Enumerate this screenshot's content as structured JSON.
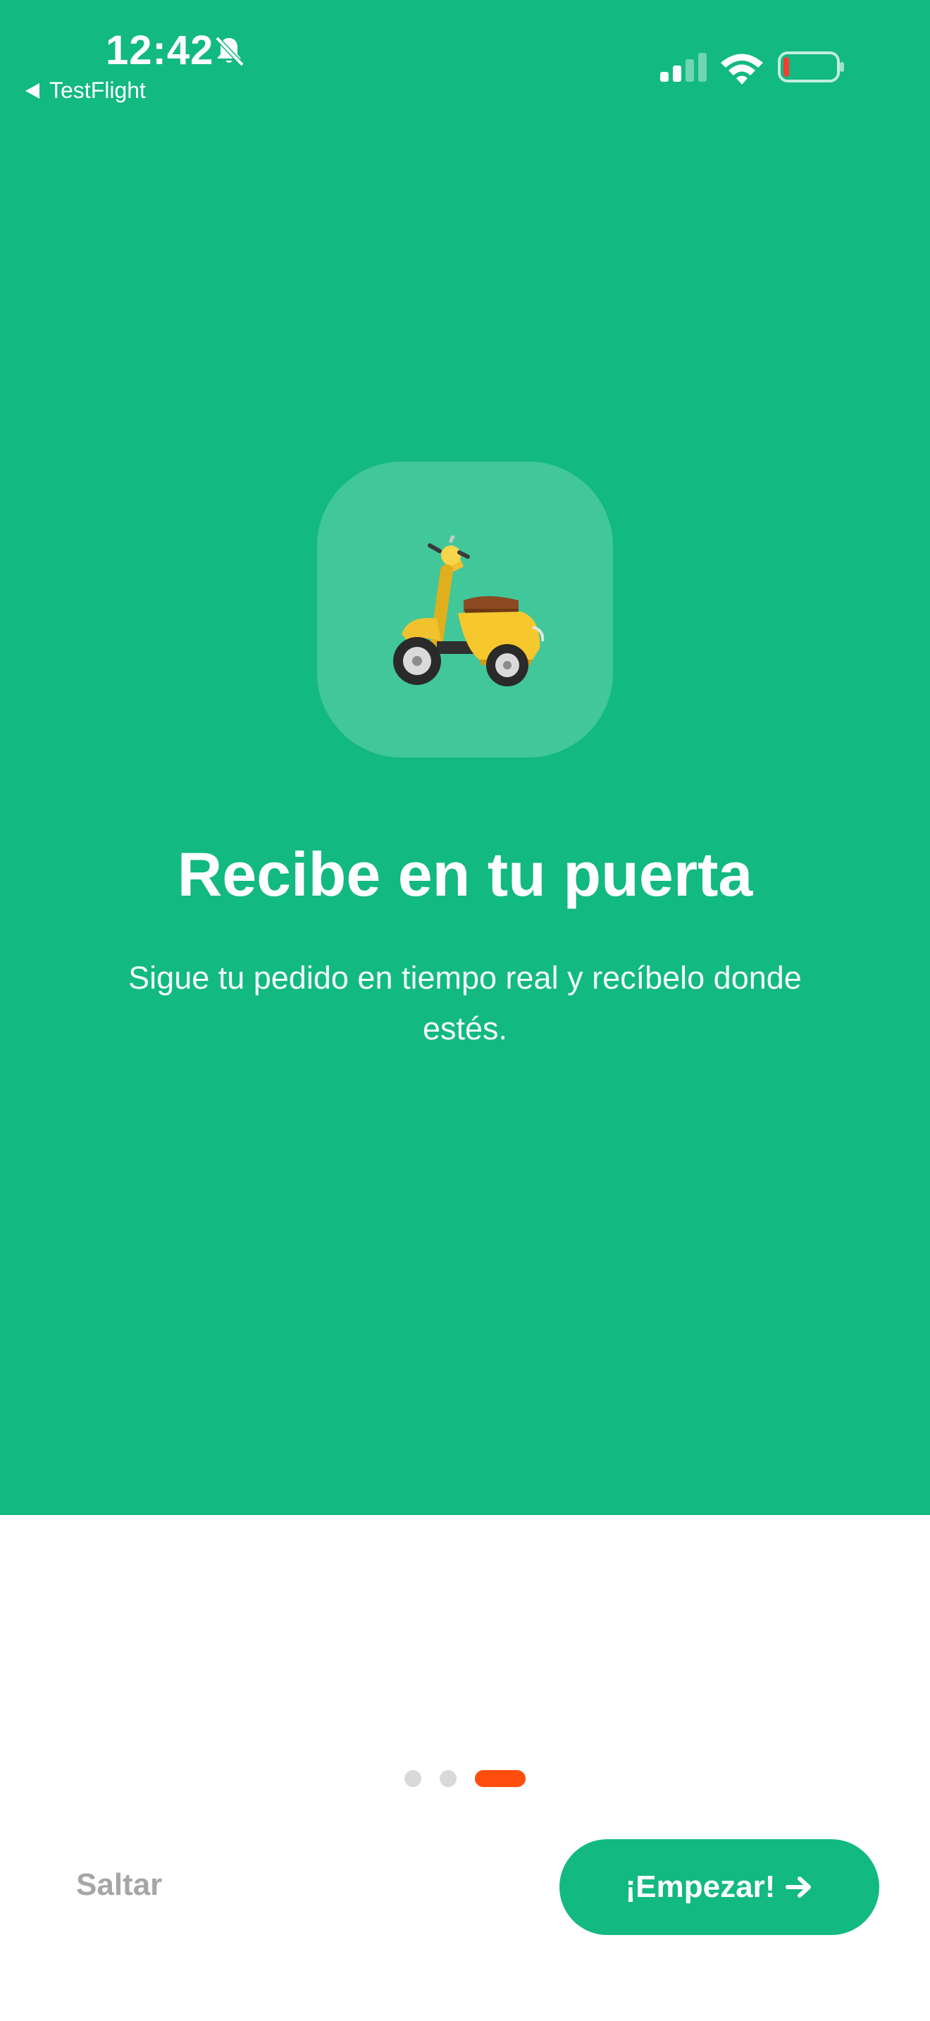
{
  "status_bar": {
    "time": "12:42",
    "back_app_label": "TestFlight",
    "icons": [
      "bell-slash-icon",
      "cellular-signal-icon",
      "wifi-icon",
      "battery-low-icon"
    ]
  },
  "hero": {
    "background_color": "#12B981",
    "illustration": "scooter-emoji",
    "title": "Recibe en tu puerta",
    "subtitle": "Sigue tu pedido en tiempo real y recíbelo donde estés."
  },
  "pager": {
    "total_pages": 3,
    "active_page": 3,
    "active_color": "#FF4D0D"
  },
  "actions": {
    "skip_label": "Saltar",
    "start_label": "¡Empezar!",
    "start_icon": "arrow-right-icon",
    "start_color": "#12B981"
  }
}
